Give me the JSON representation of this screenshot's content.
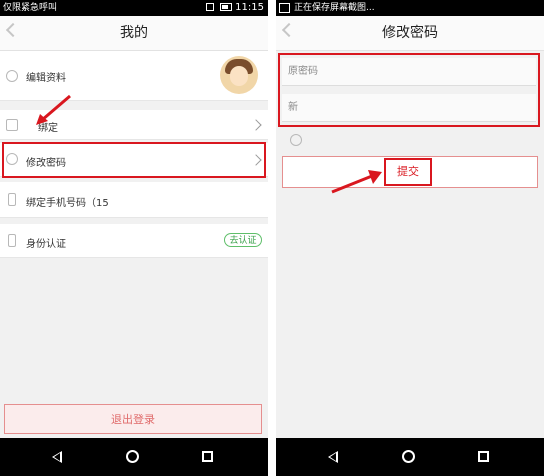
{
  "left_screen": {
    "status_bar": {
      "carrier": "仅限紧急呼叫",
      "time": "11:15"
    },
    "title": "我的",
    "rows": {
      "edit_profile": "编辑资料",
      "bind": "绑定",
      "change_password": "修改密码",
      "bind_phone": "绑定手机号码（15",
      "identity": "身份认证",
      "identity_badge": "去认证"
    },
    "logout_label": "退出登录"
  },
  "right_screen": {
    "status_bar": {
      "notification": "正在保存屏幕截图..."
    },
    "title": "修改密码",
    "fields": {
      "old_password_placeholder": "原密码",
      "new_password_placeholder": "新"
    },
    "submit_label": "提交"
  },
  "colors": {
    "highlight": "#d9171f",
    "badge_green": "#3aa14a",
    "logout_text": "#e06b6b"
  }
}
